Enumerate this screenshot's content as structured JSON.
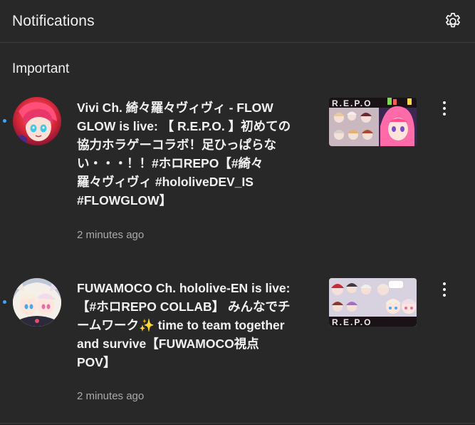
{
  "header": {
    "title": "Notifications",
    "settings_icon": "gear-icon"
  },
  "section": {
    "title": "Important"
  },
  "notifications": [
    {
      "text": "Vivi Ch. 綺々羅々ヴィヴィ - FLOW\nGLOW is live: 【 R.E.P.O. 】初めての\n協力ホラゲーコラボ！足ひっぱらな\nい・・・！！#ホロREPO【#綺々\n羅々ヴィヴィ #hololiveDEV_IS\n#FLOWGLOW】",
      "time": "2 minutes ago",
      "thumb_label": "R.E.P.O",
      "unread": true
    },
    {
      "text": "FUWAMOCO Ch. hololive-EN is live:\n【#ホロREPO COLLAB】 みんなでチ\nームワーク✨ time to team together\nand survive【FUWAMOCO視点\nPOV】",
      "time": "2 minutes ago",
      "thumb_label": "R.E.P.O",
      "unread": true
    }
  ],
  "colors": {
    "background": "#282828",
    "unread_dot": "#3ea6ff",
    "secondary_text": "#aaaaaa"
  }
}
